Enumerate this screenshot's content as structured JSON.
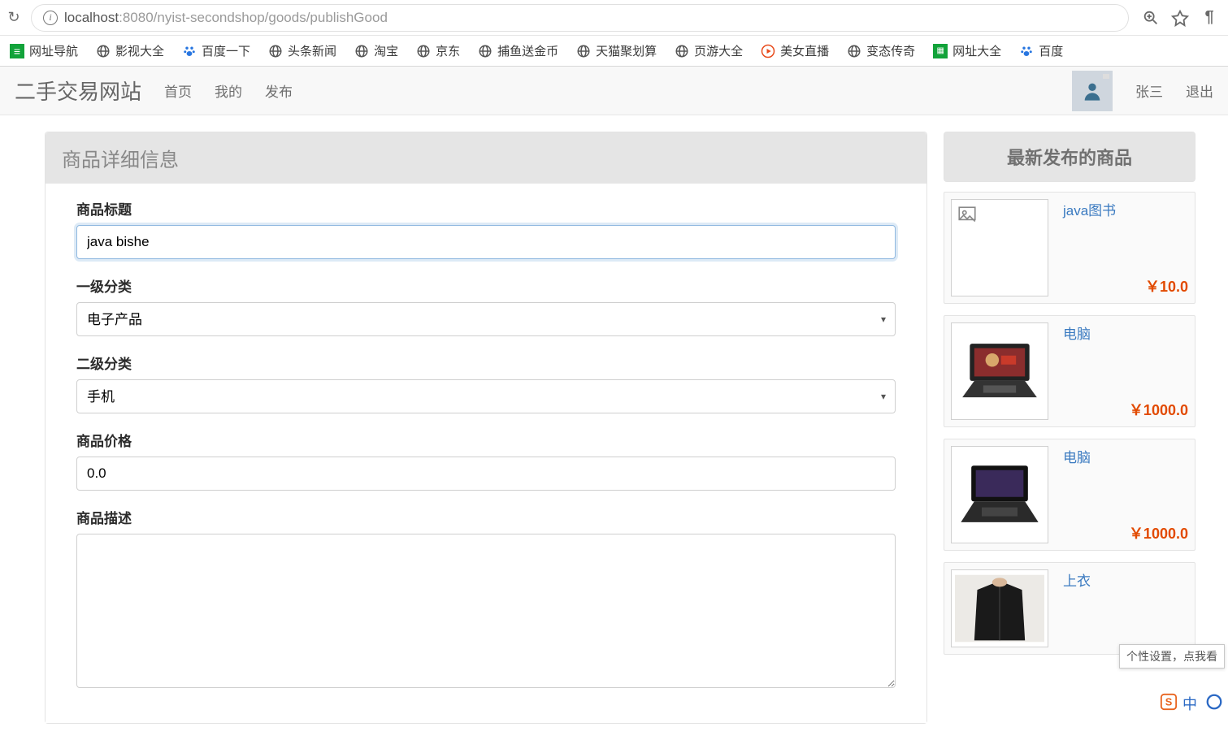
{
  "browser": {
    "url_host": "localhost",
    "url_port_path": ":8080/nyist-secondshop/goods/publishGood"
  },
  "bookmarks": [
    {
      "label": "网址导航",
      "color": "#12a33a",
      "icon": "■"
    },
    {
      "label": "影视大全",
      "color": "#555",
      "icon": "◎"
    },
    {
      "label": "百度一下",
      "color": "#2876e0",
      "icon": "paw"
    },
    {
      "label": "头条新闻",
      "color": "#555",
      "icon": "◎"
    },
    {
      "label": "淘宝",
      "color": "#555",
      "icon": "◎"
    },
    {
      "label": "京东",
      "color": "#555",
      "icon": "◎"
    },
    {
      "label": "捕鱼送金币",
      "color": "#555",
      "icon": "◎"
    },
    {
      "label": "天猫聚划算",
      "color": "#555",
      "icon": "◎"
    },
    {
      "label": "页游大全",
      "color": "#555",
      "icon": "◎"
    },
    {
      "label": "美女直播",
      "color": "#e84b1c",
      "icon": "●"
    },
    {
      "label": "变态传奇",
      "color": "#555",
      "icon": "◎"
    },
    {
      "label": "网址大全",
      "color": "#12a33a",
      "icon": "grid"
    },
    {
      "label": "百度",
      "color": "#2876e0",
      "icon": "paw"
    }
  ],
  "nav": {
    "brand": "二手交易网站",
    "links": [
      "首页",
      "我的",
      "发布"
    ],
    "user": "张三",
    "logout": "退出"
  },
  "form": {
    "panel_title": "商品详细信息",
    "labels": {
      "title": "商品标题",
      "cat1": "一级分类",
      "cat2": "二级分类",
      "price": "商品价格",
      "desc": "商品描述"
    },
    "values": {
      "title": "java bishe",
      "cat1": "电子产品",
      "cat2": "手机",
      "price": "0.0",
      "desc": ""
    }
  },
  "sidebar": {
    "heading": "最新发布的商品",
    "items": [
      {
        "title": "java图书",
        "price": "￥10.0",
        "thumb": "broken"
      },
      {
        "title": "电脑",
        "price": "￥1000.0",
        "thumb": "laptop1"
      },
      {
        "title": "电脑",
        "price": "￥1000.0",
        "thumb": "laptop2"
      },
      {
        "title": "上衣",
        "price": "",
        "thumb": "jacket"
      }
    ]
  },
  "tooltip": "个性设置，点我看"
}
